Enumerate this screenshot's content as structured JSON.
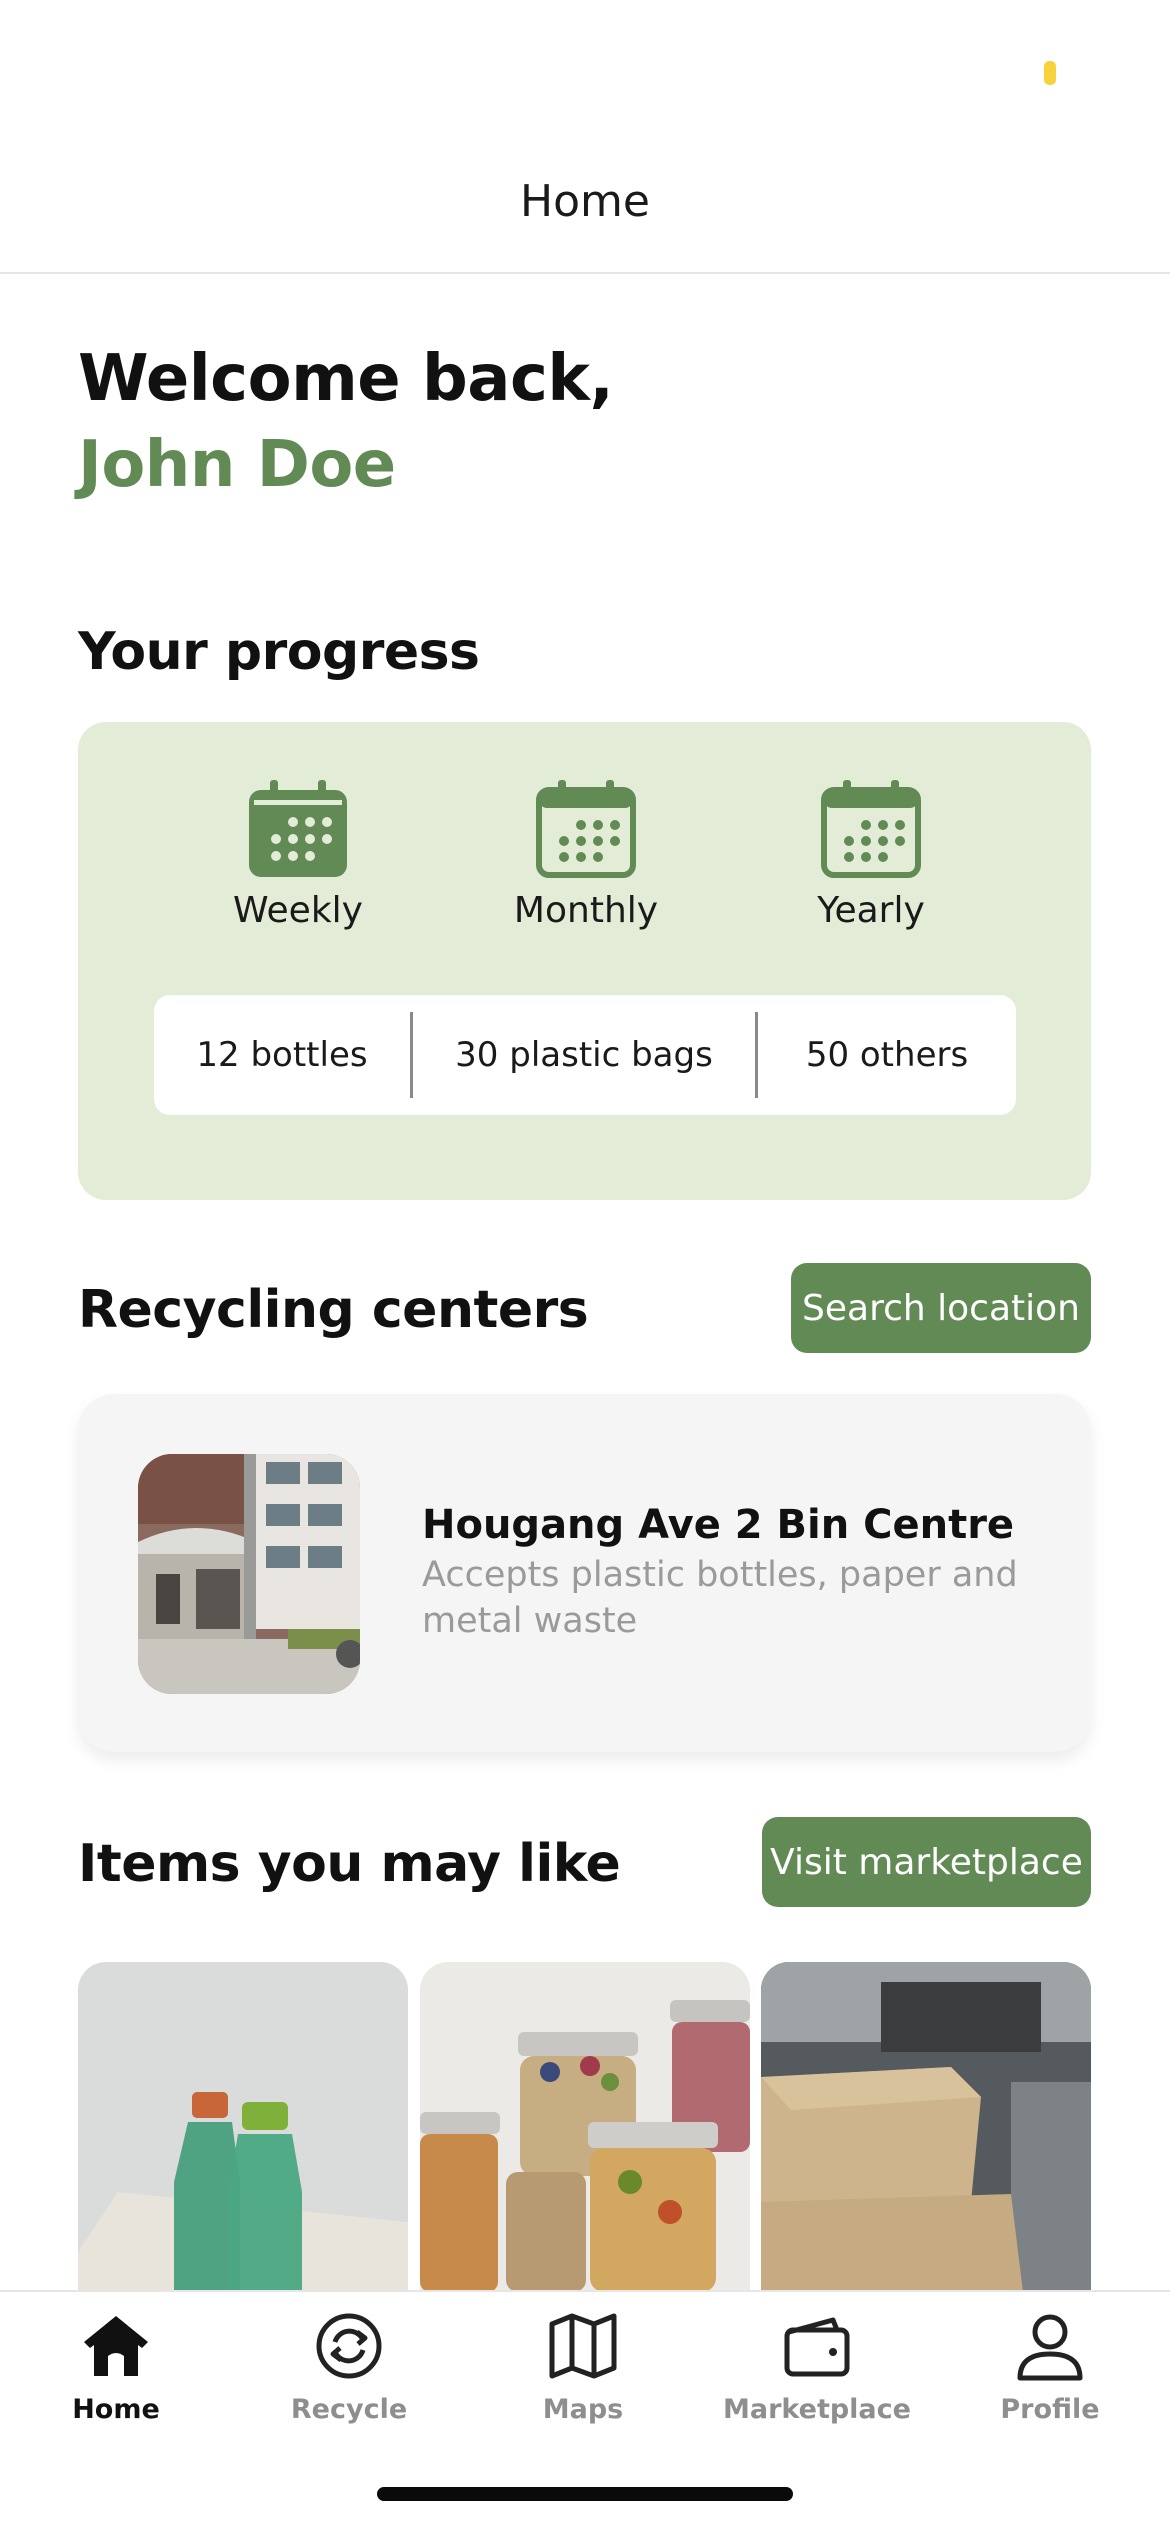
{
  "header": {
    "title": "Home"
  },
  "welcome": {
    "greeting": "Welcome back,",
    "user_name": "John Doe"
  },
  "progress": {
    "section_title": "Your progress",
    "periods": [
      {
        "label": "Weekly",
        "icon": "calendar-icon"
      },
      {
        "label": "Monthly",
        "icon": "calendar-icon"
      },
      {
        "label": "Yearly",
        "icon": "calendar-icon"
      }
    ],
    "stats": [
      {
        "label": "12 bottles"
      },
      {
        "label": "30 plastic bags"
      },
      {
        "label": "50 others"
      }
    ]
  },
  "recycling": {
    "section_title": "Recycling centers",
    "search_button": "Search location",
    "centers": [
      {
        "name": "Hougang Ave 2 Bin Centre",
        "description": "Accepts plastic bottles, paper and metal waste"
      }
    ]
  },
  "items": {
    "section_title": "Items you may like",
    "marketplace_button": "Visit marketplace"
  },
  "tabs": [
    {
      "label": "Home",
      "icon": "home-icon",
      "active": true
    },
    {
      "label": "Recycle",
      "icon": "recycle-icon",
      "active": false
    },
    {
      "label": "Maps",
      "icon": "map-icon",
      "active": false
    },
    {
      "label": "Marketplace",
      "icon": "wallet-icon",
      "active": false
    },
    {
      "label": "Profile",
      "icon": "profile-icon",
      "active": false
    }
  ],
  "colors": {
    "accent": "#628a55",
    "progress_card_bg": "#e3ecd6",
    "status_indicator": "#f6d33c"
  }
}
